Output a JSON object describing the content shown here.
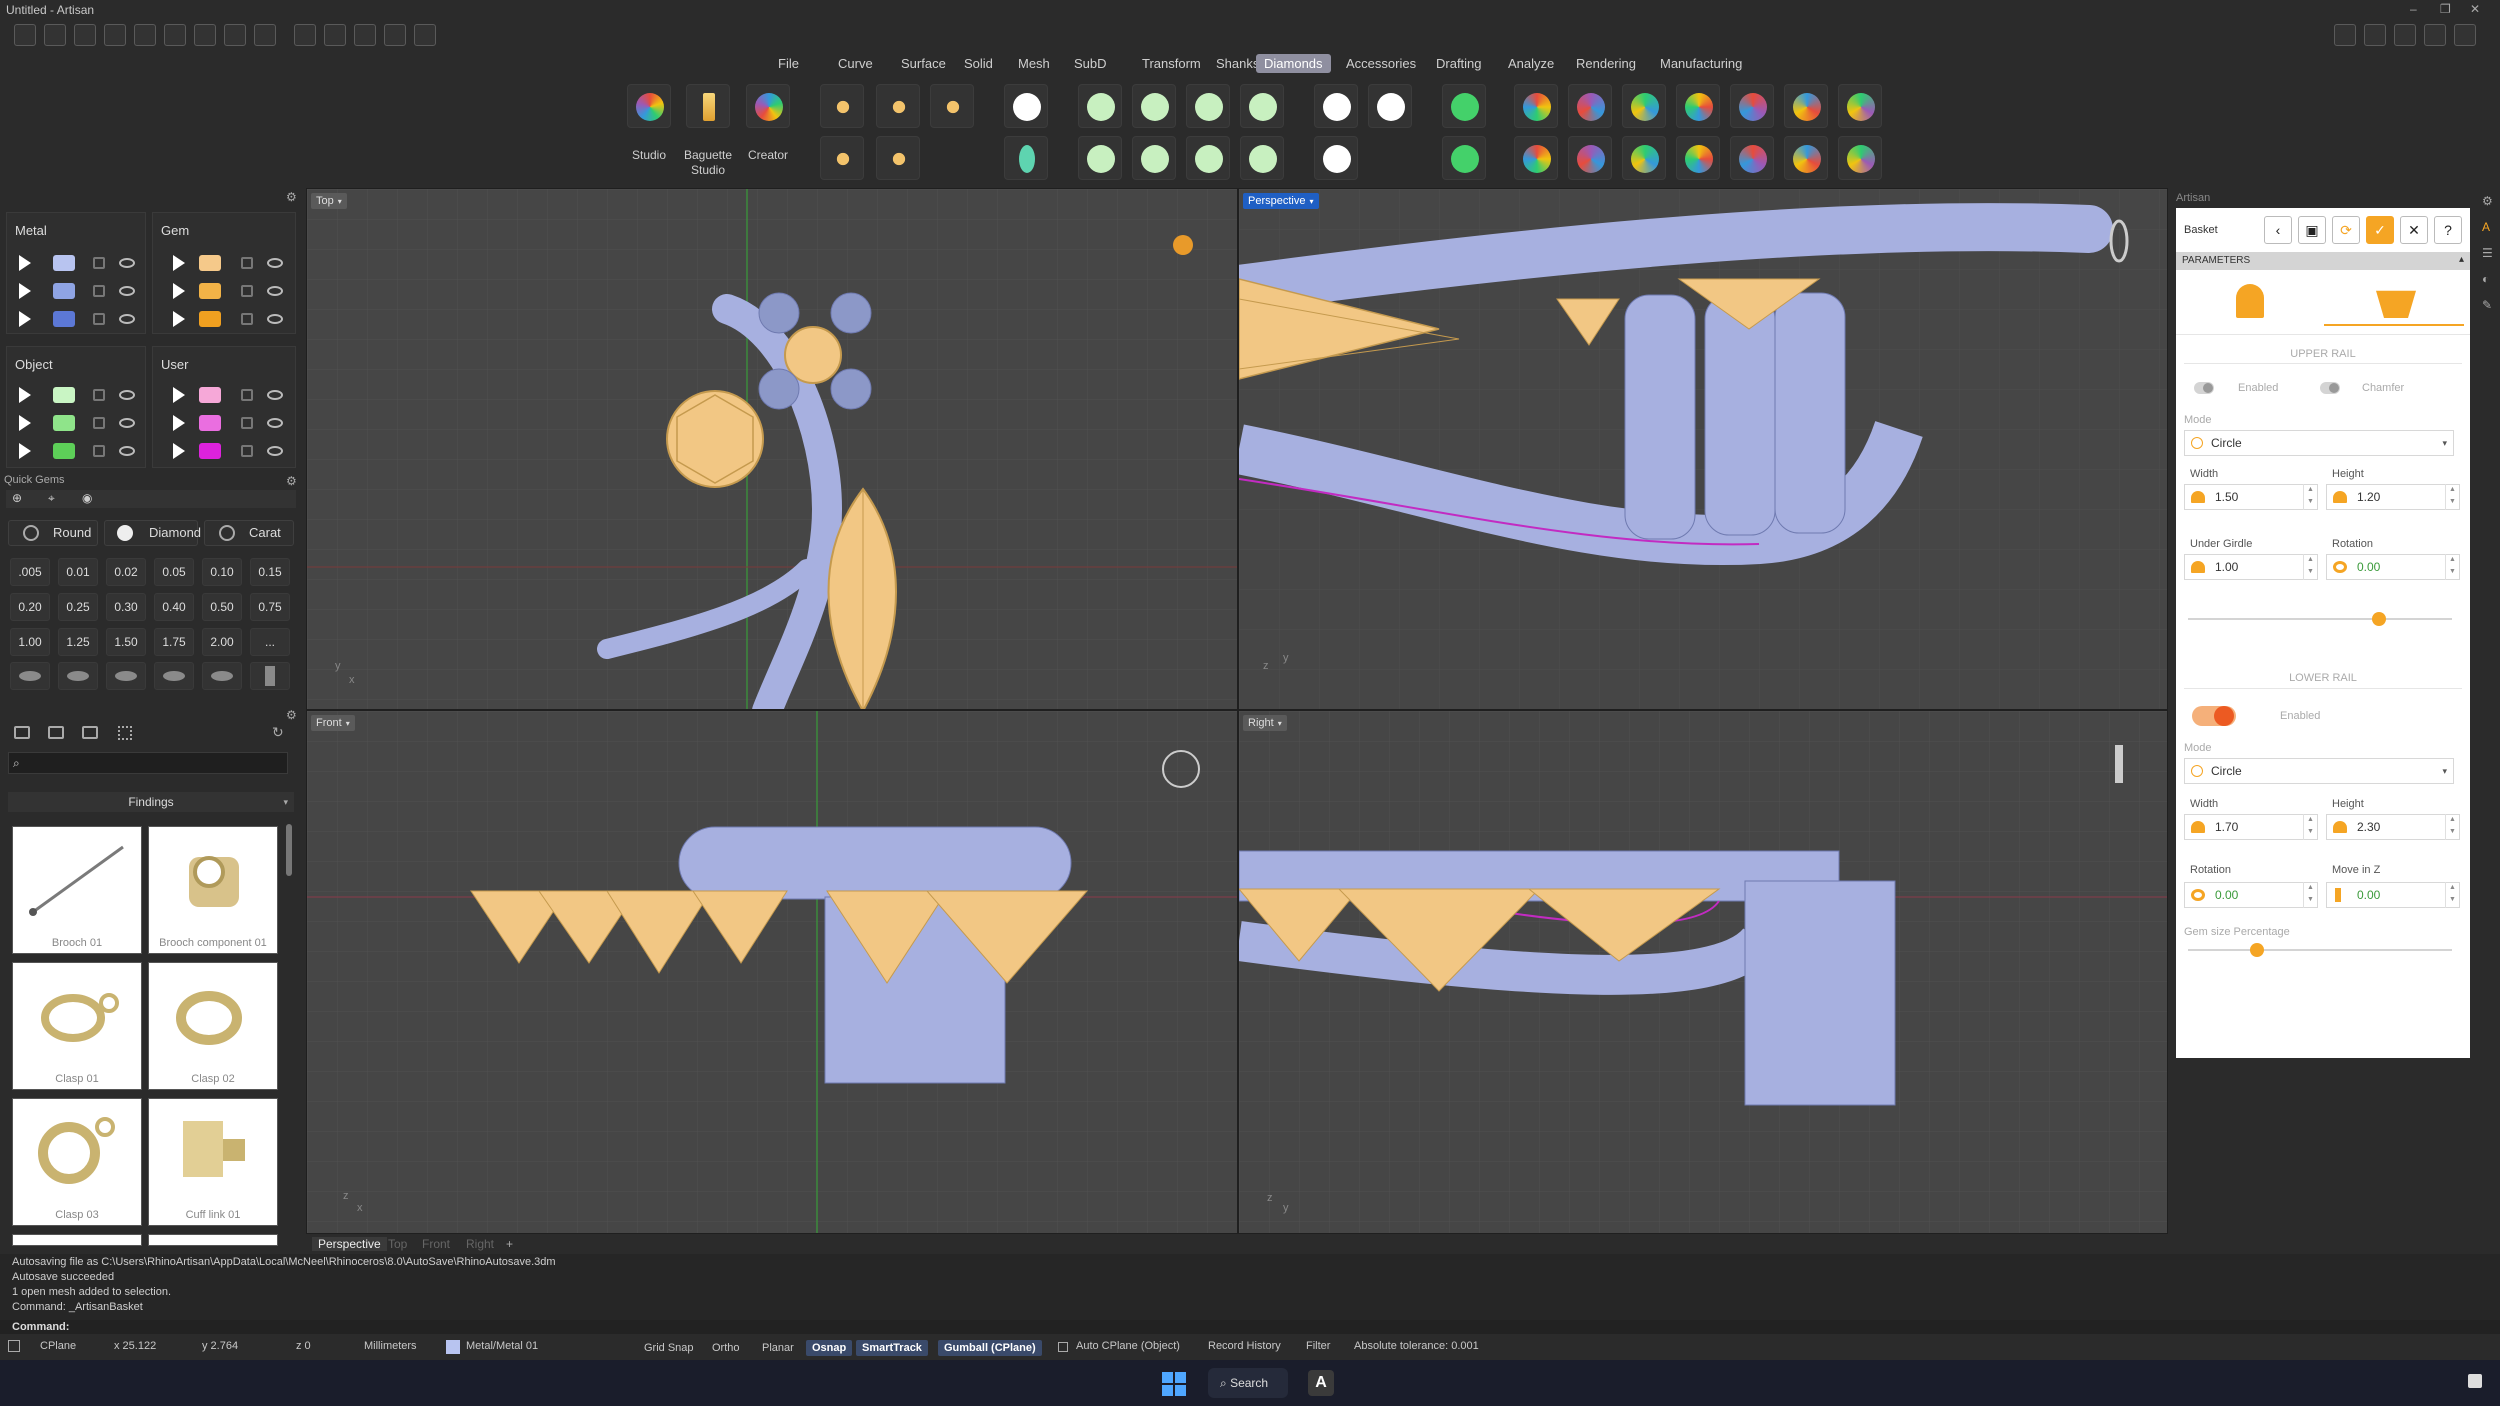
{
  "window": {
    "title": "Untitled - Artisan"
  },
  "menu": {
    "items": [
      "File",
      "Curve",
      "Surface",
      "Solid",
      "Mesh",
      "SubD",
      "Transform",
      "Shanks",
      "Diamonds",
      "Accessories",
      "Drafting",
      "Analyze",
      "Rendering",
      "Manufacturing"
    ],
    "active": "Diamonds"
  },
  "ribbon": {
    "labels": {
      "studio": "Studio",
      "baguette_l1": "Baguette",
      "baguette_l2": "Studio",
      "creator": "Creator"
    }
  },
  "layers": {
    "groups": [
      {
        "title": "Metal",
        "swatches": [
          "#b8c4f0",
          "#8fa4e4",
          "#5c78d6"
        ]
      },
      {
        "title": "Gem",
        "swatches": [
          "#f5c98a",
          "#f2b347",
          "#f0a020"
        ]
      },
      {
        "title": "Object",
        "swatches": [
          "#c9f5c4",
          "#8fe48a",
          "#5dcf58"
        ]
      },
      {
        "title": "User",
        "swatches": [
          "#f6a8d8",
          "#ea6ee0",
          "#dd22dd"
        ]
      }
    ]
  },
  "quick_gems": {
    "title": "Quick Gems",
    "shape_label": "Round",
    "material_label": "Diamond",
    "unit_label": "Carat",
    "carats": [
      ".005",
      "0.01",
      "0.02",
      "0.05",
      "0.10",
      "0.15",
      "0.20",
      "0.25",
      "0.30",
      "0.40",
      "0.50",
      "0.75",
      "1.00",
      "1.25",
      "1.50",
      "1.75",
      "2.00",
      "..."
    ]
  },
  "library": {
    "search_placeholder": "",
    "category": "Findings",
    "items": [
      "Brooch 01",
      "Brooch component 01",
      "Clasp 01",
      "Clasp 02",
      "Clasp 03",
      "Cuff link 01"
    ]
  },
  "viewports": {
    "top": "Top",
    "perspective": "Perspective",
    "front": "Front",
    "right": "Right"
  },
  "view_tabs": [
    "Perspective",
    "Top",
    "Front",
    "Right"
  ],
  "artisan": {
    "panel_title": "Artisan",
    "basket_label": "Basket",
    "section": "PARAMETERS",
    "upper_rail": {
      "title": "UPPER RAIL",
      "enabled": "Enabled",
      "chamfer": "Chamfer",
      "mode_label": "Mode",
      "mode_value": "Circle",
      "width_label": "Width",
      "width": "1.50",
      "height_label": "Height",
      "height": "1.20",
      "under_girdle_label": "Under Girdle",
      "under_girdle": "1.00",
      "rotation_label": "Rotation",
      "rotation": "0.00"
    },
    "lower_rail": {
      "title": "LOWER RAIL",
      "enabled": "Enabled",
      "mode_label": "Mode",
      "mode_value": "Circle",
      "width_label": "Width",
      "width": "1.70",
      "height_label": "Height",
      "height": "2.30",
      "rotation_label": "Rotation",
      "rotation": "0.00",
      "move_label": "Move in Z",
      "move": "0.00"
    },
    "gem_size_label": "Gem size Percentage"
  },
  "command_history": [
    "Autosaving file as C:\\Users\\RhinoArtisan\\AppData\\Local\\McNeel\\Rhinoceros\\8.0\\AutoSave\\RhinoAutosave.3dm",
    "Autosave succeeded",
    "1 open mesh added to selection.",
    "Command: _ArtisanBasket"
  ],
  "command_prompt": "Command:",
  "status": {
    "cplane": "CPlane",
    "x": "x 25.122",
    "y": "y 2.764",
    "z": "z 0",
    "units": "Millimeters",
    "layer": "Metal/Metal 01",
    "grid_snap": "Grid Snap",
    "ortho": "Ortho",
    "planar": "Planar",
    "osnap": "Osnap",
    "smarttrack": "SmartTrack",
    "gumball": "Gumball (CPlane)",
    "auto_cplane": "Auto CPlane (Object)",
    "record_history": "Record History",
    "filter": "Filter",
    "tolerance": "Absolute tolerance: 0.001"
  },
  "taskbar": {
    "search": "Search"
  }
}
